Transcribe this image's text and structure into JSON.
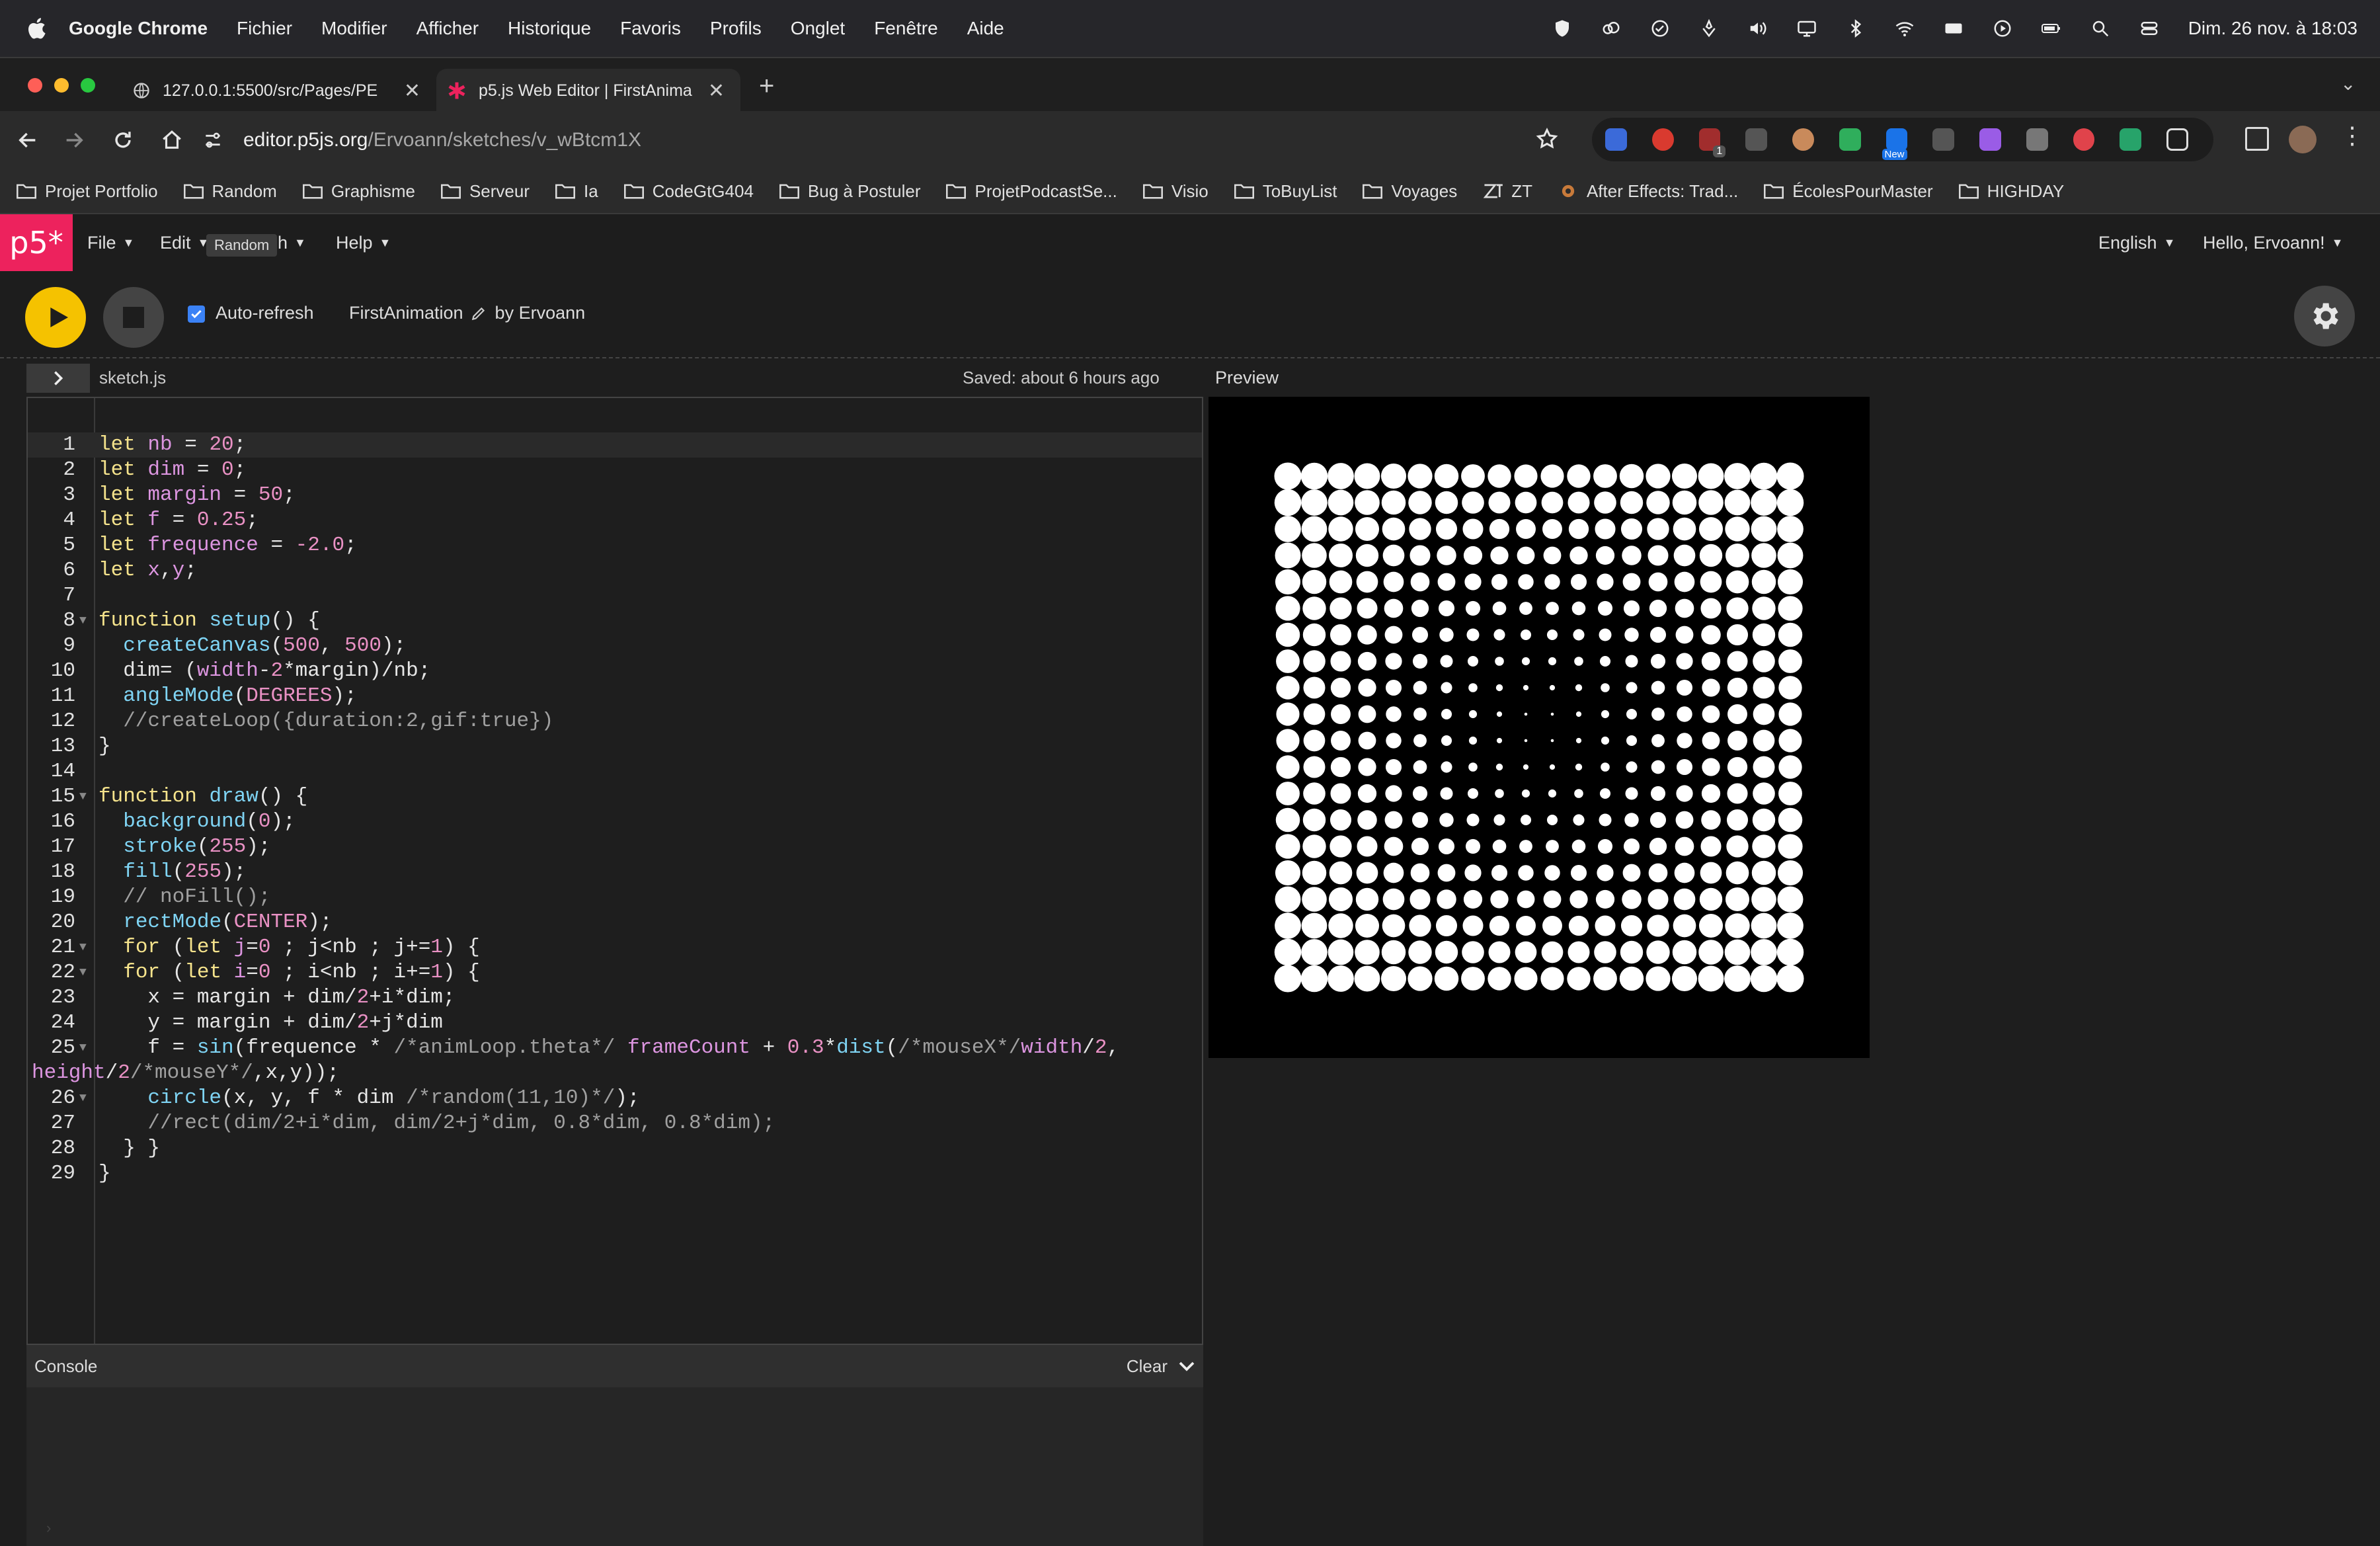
{
  "menubar": {
    "items": [
      "Google Chrome",
      "Fichier",
      "Modifier",
      "Afficher",
      "Historique",
      "Favoris",
      "Profils",
      "Onglet",
      "Fenêtre",
      "Aide"
    ],
    "datetime": "Dim. 26 nov. à 18:03"
  },
  "tabs": [
    {
      "title": "127.0.0.1:5500/src/Pages/PE",
      "active": false
    },
    {
      "title": "p5.js Web Editor | FirstAnima",
      "active": true
    }
  ],
  "address": {
    "domain": "editor.p5js.org",
    "path": "/Ervoann/sketches/v_wBtcm1X"
  },
  "extensions": {
    "badge_count": "1",
    "new_label": "New"
  },
  "bookmarks": [
    {
      "label": "Projet Portfolio",
      "icon": "folder-icon"
    },
    {
      "label": "Random",
      "icon": "folder-icon"
    },
    {
      "label": "Graphisme",
      "icon": "folder-icon"
    },
    {
      "label": "Serveur",
      "icon": "folder-icon"
    },
    {
      "label": "Ia",
      "icon": "folder-icon"
    },
    {
      "label": "CodeGtG404",
      "icon": "folder-icon"
    },
    {
      "label": "Bug à Postuler",
      "icon": "folder-icon"
    },
    {
      "label": "ProjetPodcastSe...",
      "icon": "folder-icon"
    },
    {
      "label": "Visio",
      "icon": "folder-icon"
    },
    {
      "label": "ToBuyList",
      "icon": "folder-icon"
    },
    {
      "label": "Voyages",
      "icon": "folder-icon"
    },
    {
      "label": "ZT",
      "icon": "zt-icon"
    },
    {
      "label": "After Effects: Trad...",
      "icon": "site-icon"
    },
    {
      "label": "ÉcolesPourMaster",
      "icon": "folder-icon"
    },
    {
      "label": "HIGHDAY",
      "icon": "folder-icon"
    }
  ],
  "p5nav": {
    "logo": "p5*",
    "file": "File",
    "edit": "Edit",
    "sketch_tail": "h",
    "tooltip": "Random",
    "help": "Help",
    "language": "English",
    "user": "Hello, Ervoann!"
  },
  "toolbar": {
    "autorefresh_label": "Auto-refresh",
    "autorefresh_checked": true,
    "sketch_name": "FirstAnimation",
    "by": "by Ervoann"
  },
  "editor": {
    "filename": "sketch.js",
    "saved": "Saved: about 6 hours ago",
    "preview_label": "Preview"
  },
  "console": {
    "label": "Console",
    "clear": "Clear"
  },
  "colors": {
    "p5_pink": "#ED225D",
    "play_yellow": "#F5C200"
  },
  "code_lines": [
    {
      "n": "1",
      "fold": false,
      "tokens": [
        [
          "kw",
          "let"
        ],
        [
          "pl",
          " "
        ],
        [
          "vr",
          "nb"
        ],
        [
          "pl",
          " = "
        ],
        [
          "num",
          "20"
        ],
        [
          "pl",
          ";"
        ]
      ]
    },
    {
      "n": "2",
      "fold": false,
      "tokens": [
        [
          "kw",
          "let"
        ],
        [
          "pl",
          " "
        ],
        [
          "vr",
          "dim"
        ],
        [
          "pl",
          " = "
        ],
        [
          "num",
          "0"
        ],
        [
          "pl",
          ";"
        ]
      ]
    },
    {
      "n": "3",
      "fold": false,
      "tokens": [
        [
          "kw",
          "let"
        ],
        [
          "pl",
          " "
        ],
        [
          "vr",
          "margin"
        ],
        [
          "pl",
          " = "
        ],
        [
          "num",
          "50"
        ],
        [
          "pl",
          ";"
        ]
      ]
    },
    {
      "n": "4",
      "fold": false,
      "tokens": [
        [
          "kw",
          "let"
        ],
        [
          "pl",
          " "
        ],
        [
          "vr",
          "f"
        ],
        [
          "pl",
          " = "
        ],
        [
          "num",
          "0.25"
        ],
        [
          "pl",
          ";"
        ]
      ]
    },
    {
      "n": "5",
      "fold": false,
      "tokens": [
        [
          "kw",
          "let"
        ],
        [
          "pl",
          " "
        ],
        [
          "vr",
          "frequence"
        ],
        [
          "pl",
          " = "
        ],
        [
          "num",
          "-2.0"
        ],
        [
          "pl",
          ";"
        ]
      ]
    },
    {
      "n": "6",
      "fold": false,
      "tokens": [
        [
          "kw",
          "let"
        ],
        [
          "pl",
          " "
        ],
        [
          "vr",
          "x"
        ],
        [
          "pl",
          ","
        ],
        [
          "vr",
          "y"
        ],
        [
          "pl",
          ";"
        ]
      ]
    },
    {
      "n": "7",
      "fold": false,
      "tokens": []
    },
    {
      "n": "8",
      "fold": true,
      "tokens": [
        [
          "kw",
          "function"
        ],
        [
          "pl",
          " "
        ],
        [
          "fn",
          "setup"
        ],
        [
          "pl",
          "() {"
        ]
      ]
    },
    {
      "n": "9",
      "fold": false,
      "tokens": [
        [
          "pl",
          "  "
        ],
        [
          "fn",
          "createCanvas"
        ],
        [
          "pl",
          "("
        ],
        [
          "num",
          "500"
        ],
        [
          "pl",
          ", "
        ],
        [
          "num",
          "500"
        ],
        [
          "pl",
          ");"
        ]
      ]
    },
    {
      "n": "10",
      "fold": false,
      "tokens": [
        [
          "pl",
          "  dim= ("
        ],
        [
          "vr",
          "width"
        ],
        [
          "pl",
          "-"
        ],
        [
          "num",
          "2"
        ],
        [
          "pl",
          "*margin)/nb;"
        ]
      ]
    },
    {
      "n": "11",
      "fold": false,
      "tokens": [
        [
          "pl",
          "  "
        ],
        [
          "fn",
          "angleMode"
        ],
        [
          "pl",
          "("
        ],
        [
          "cst",
          "DEGREES"
        ],
        [
          "pl",
          ");"
        ]
      ]
    },
    {
      "n": "12",
      "fold": false,
      "tokens": [
        [
          "cm",
          "  //createLoop({duration:2,gif:true})"
        ]
      ]
    },
    {
      "n": "13",
      "fold": false,
      "tokens": [
        [
          "pl",
          "}"
        ]
      ]
    },
    {
      "n": "14",
      "fold": false,
      "tokens": []
    },
    {
      "n": "15",
      "fold": true,
      "tokens": [
        [
          "kw",
          "function"
        ],
        [
          "pl",
          " "
        ],
        [
          "fn",
          "draw"
        ],
        [
          "pl",
          "() {"
        ]
      ]
    },
    {
      "n": "16",
      "fold": false,
      "tokens": [
        [
          "pl",
          "  "
        ],
        [
          "fn",
          "background"
        ],
        [
          "pl",
          "("
        ],
        [
          "num",
          "0"
        ],
        [
          "pl",
          ");"
        ]
      ]
    },
    {
      "n": "17",
      "fold": false,
      "tokens": [
        [
          "pl",
          "  "
        ],
        [
          "fn",
          "stroke"
        ],
        [
          "pl",
          "("
        ],
        [
          "num",
          "255"
        ],
        [
          "pl",
          ");"
        ]
      ]
    },
    {
      "n": "18",
      "fold": false,
      "tokens": [
        [
          "pl",
          "  "
        ],
        [
          "fn",
          "fill"
        ],
        [
          "pl",
          "("
        ],
        [
          "num",
          "255"
        ],
        [
          "pl",
          ");"
        ]
      ]
    },
    {
      "n": "19",
      "fold": false,
      "tokens": [
        [
          "cm",
          "  // noFill();"
        ]
      ]
    },
    {
      "n": "20",
      "fold": false,
      "tokens": [
        [
          "pl",
          "  "
        ],
        [
          "fn",
          "rectMode"
        ],
        [
          "pl",
          "("
        ],
        [
          "cst",
          "CENTER"
        ],
        [
          "pl",
          ");"
        ]
      ]
    },
    {
      "n": "21",
      "fold": true,
      "tokens": [
        [
          "pl",
          "  "
        ],
        [
          "kw",
          "for"
        ],
        [
          "pl",
          " ("
        ],
        [
          "kw",
          "let"
        ],
        [
          "pl",
          " "
        ],
        [
          "vr",
          "j"
        ],
        [
          "pl",
          "="
        ],
        [
          "num",
          "0"
        ],
        [
          "pl",
          " ; j<nb ; j+="
        ],
        [
          "num",
          "1"
        ],
        [
          "pl",
          ") {"
        ]
      ]
    },
    {
      "n": "22",
      "fold": true,
      "tokens": [
        [
          "pl",
          "  "
        ],
        [
          "kw",
          "for"
        ],
        [
          "pl",
          " ("
        ],
        [
          "kw",
          "let"
        ],
        [
          "pl",
          " "
        ],
        [
          "vr",
          "i"
        ],
        [
          "pl",
          "="
        ],
        [
          "num",
          "0"
        ],
        [
          "pl",
          " ; i<nb ; i+="
        ],
        [
          "num",
          "1"
        ],
        [
          "pl",
          ") {"
        ]
      ]
    },
    {
      "n": "23",
      "fold": false,
      "tokens": [
        [
          "pl",
          "    x = margin + dim/"
        ],
        [
          "num",
          "2"
        ],
        [
          "pl",
          "+i*dim;"
        ]
      ]
    },
    {
      "n": "24",
      "fold": false,
      "tokens": [
        [
          "pl",
          "    y = margin + dim/"
        ],
        [
          "num",
          "2"
        ],
        [
          "pl",
          "+j*dim"
        ]
      ]
    },
    {
      "n": "25",
      "fold": true,
      "tokens": [
        [
          "pl",
          "    f = "
        ],
        [
          "fn",
          "sin"
        ],
        [
          "pl",
          "(frequence * "
        ],
        [
          "cm",
          "/*animLoop.theta*/"
        ],
        [
          "pl",
          " "
        ],
        [
          "vr",
          "frameCount"
        ],
        [
          "pl",
          " + "
        ],
        [
          "num",
          "0.3"
        ],
        [
          "pl",
          "*"
        ],
        [
          "fn",
          "dist"
        ],
        [
          "pl",
          "("
        ],
        [
          "cm",
          "/*mouseX*/"
        ],
        [
          "vr",
          "width"
        ],
        [
          "pl",
          "/"
        ],
        [
          "num",
          "2"
        ],
        [
          "pl",
          ","
        ]
      ]
    },
    {
      "n": "",
      "fold": false,
      "wrap": true,
      "tokens": [
        [
          "vr",
          "height"
        ],
        [
          "pl",
          "/"
        ],
        [
          "num",
          "2"
        ],
        [
          "cm",
          "/*mouseY*/"
        ],
        [
          "pl",
          ",x,y));"
        ]
      ]
    },
    {
      "n": "26",
      "fold": true,
      "tokens": [
        [
          "pl",
          "    "
        ],
        [
          "fn",
          "circle"
        ],
        [
          "pl",
          "(x, y, f * dim "
        ],
        [
          "cm",
          "/*random(11,10)*/"
        ],
        [
          "pl",
          ");"
        ]
      ]
    },
    {
      "n": "27",
      "fold": false,
      "tokens": [
        [
          "cm",
          "    //rect(dim/2+i*dim, dim/2+j*dim, 0.8*dim, 0.8*dim);"
        ]
      ]
    },
    {
      "n": "28",
      "fold": false,
      "tokens": [
        [
          "pl",
          "  } }"
        ]
      ]
    },
    {
      "n": "29",
      "fold": false,
      "tokens": [
        [
          "pl",
          "}"
        ]
      ]
    }
  ]
}
